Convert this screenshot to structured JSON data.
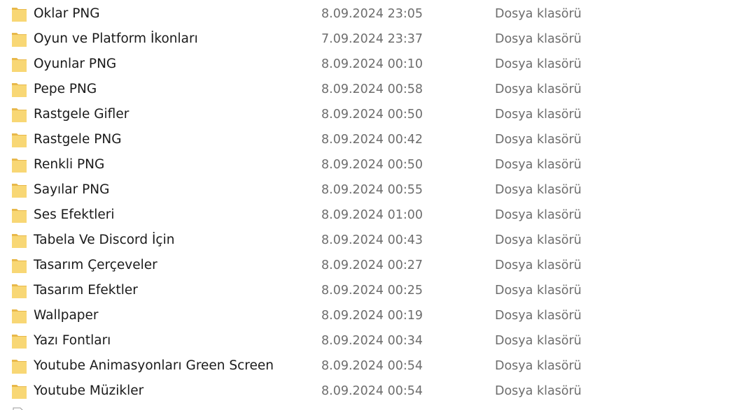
{
  "colors": {
    "folder_body": "#f8d775",
    "folder_tab": "#e8b84a",
    "name_text": "#1a1a1a",
    "meta_text": "#6d6d6d"
  },
  "rows": [
    {
      "name": "Oklar PNG",
      "date": "8.09.2024 23:05",
      "type": "Dosya klasörü",
      "icon": "folder-icon"
    },
    {
      "name": "Oyun ve Platform İkonları",
      "date": "7.09.2024 23:37",
      "type": "Dosya klasörü",
      "icon": "folder-icon"
    },
    {
      "name": "Oyunlar PNG",
      "date": "8.09.2024 00:10",
      "type": "Dosya klasörü",
      "icon": "folder-icon"
    },
    {
      "name": "Pepe PNG",
      "date": "8.09.2024 00:58",
      "type": "Dosya klasörü",
      "icon": "folder-icon"
    },
    {
      "name": "Rastgele Gifler",
      "date": "8.09.2024 00:50",
      "type": "Dosya klasörü",
      "icon": "folder-icon"
    },
    {
      "name": "Rastgele PNG",
      "date": "8.09.2024 00:42",
      "type": "Dosya klasörü",
      "icon": "folder-icon"
    },
    {
      "name": "Renkli PNG",
      "date": "8.09.2024 00:50",
      "type": "Dosya klasörü",
      "icon": "folder-icon"
    },
    {
      "name": "Sayılar PNG",
      "date": "8.09.2024 00:55",
      "type": "Dosya klasörü",
      "icon": "folder-icon"
    },
    {
      "name": "Ses Efektleri",
      "date": "8.09.2024 01:00",
      "type": "Dosya klasörü",
      "icon": "folder-icon"
    },
    {
      "name": "Tabela Ve Discord İçin",
      "date": "8.09.2024 00:43",
      "type": "Dosya klasörü",
      "icon": "folder-icon"
    },
    {
      "name": "Tasarım Çerçeveler",
      "date": "8.09.2024 00:27",
      "type": "Dosya klasörü",
      "icon": "folder-icon"
    },
    {
      "name": "Tasarım Efektler",
      "date": "8.09.2024 00:25",
      "type": "Dosya klasörü",
      "icon": "folder-icon"
    },
    {
      "name": "Wallpaper",
      "date": "8.09.2024 00:19",
      "type": "Dosya klasörü",
      "icon": "folder-icon"
    },
    {
      "name": "Yazı Fontları",
      "date": "8.09.2024 00:34",
      "type": "Dosya klasörü",
      "icon": "folder-icon"
    },
    {
      "name": "Youtube Animasyonları Green Screen",
      "date": "8.09.2024 00:54",
      "type": "Dosya klasörü",
      "icon": "folder-icon"
    },
    {
      "name": "Youtube Müzikler",
      "date": "8.09.2024 00:54",
      "type": "Dosya klasörü",
      "icon": "folder-icon"
    }
  ],
  "partial_row": {
    "icon": "document-icon"
  }
}
